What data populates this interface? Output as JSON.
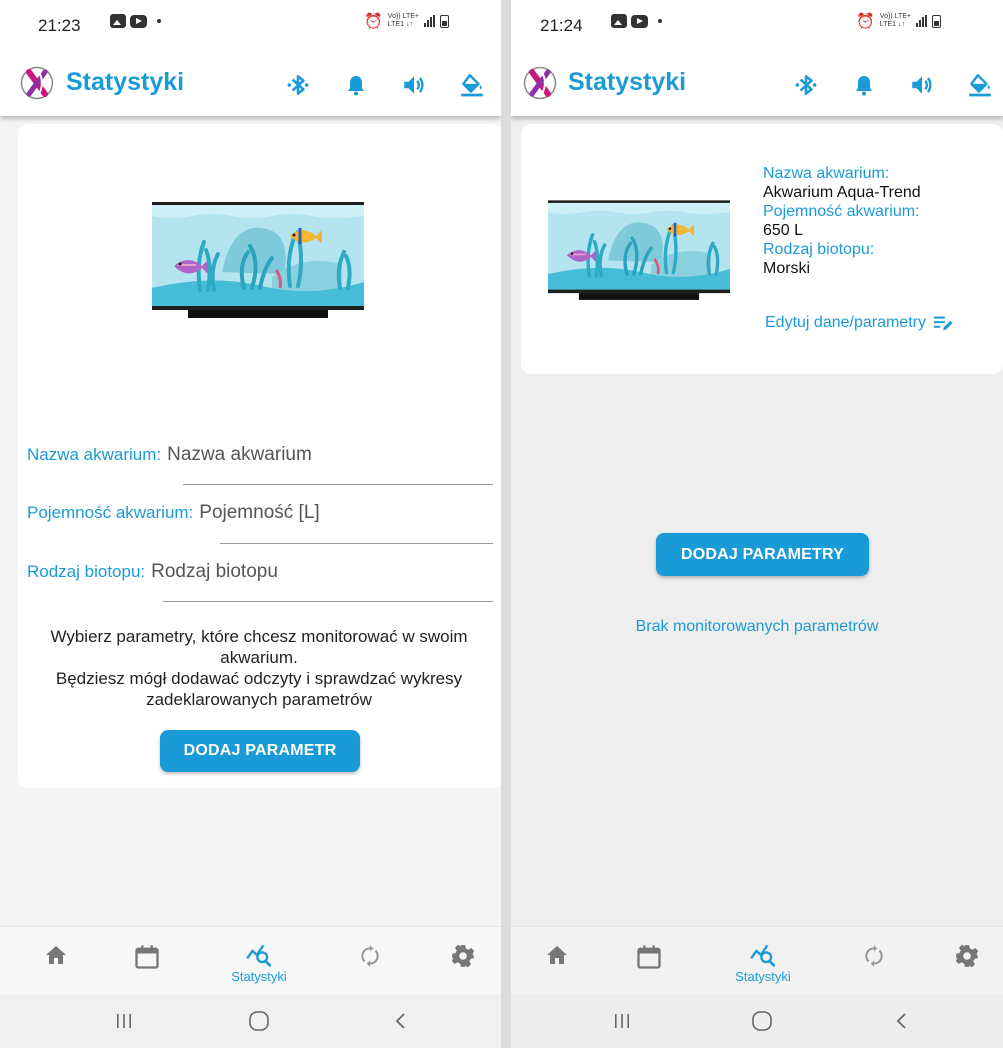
{
  "colors": {
    "accent": "#1a9bd7",
    "water": "#bfe8f2",
    "sand": "#55c6de",
    "stand": "#111111"
  },
  "left": {
    "status": {
      "time": "21:23",
      "network": [
        "Vo)) LTE+",
        "LTE1 ↓↑"
      ]
    },
    "app_bar": {
      "title": "Statystyki",
      "icons": [
        "bluetooth-icon",
        "bell-icon",
        "volume-icon",
        "paint-bucket-icon"
      ]
    },
    "form": {
      "name_label": "Nazwa akwarium:",
      "name_placeholder": "Nazwa akwarium",
      "volume_label": "Pojemność akwarium:",
      "volume_placeholder": "Pojemność [L]",
      "biotope_label": "Rodzaj biotopu:",
      "biotope_placeholder": "Rodzaj biotopu"
    },
    "info": {
      "line1": "Wybierz parametry, które chcesz monitorować w swoim akwarium.",
      "line2": "Będziesz mógł dodawać odczyty i sprawdzać wykresy zadeklarowanych parametrów"
    },
    "add_button": "DODAJ PARAMETR",
    "nav": {
      "active_label": "Statystyki",
      "icons": [
        "home-icon",
        "calendar-icon",
        "stats-icon",
        "sync-icon",
        "settings-icon"
      ]
    }
  },
  "right": {
    "status": {
      "time": "21:24",
      "network": [
        "Vo)) LTE+",
        "LTE1 ↓↑"
      ]
    },
    "app_bar": {
      "title": "Statystyki"
    },
    "details": {
      "name_label": "Nazwa akwarium:",
      "name_value": "Akwarium Aqua-Trend",
      "volume_label": "Pojemność akwarium:",
      "volume_value": "650 L",
      "biotope_label": "Rodzaj biotopu:",
      "biotope_value": "Morski"
    },
    "edit_link": "Edytuj dane/parametry",
    "empty_message": "Brak monitorowanych parametrów",
    "add_button": "DODAJ PARAMETRY",
    "nav": {
      "active_label": "Statystyki"
    }
  },
  "system_nav": {
    "icons": [
      "recents-icon",
      "home-circle-icon",
      "back-icon"
    ]
  }
}
